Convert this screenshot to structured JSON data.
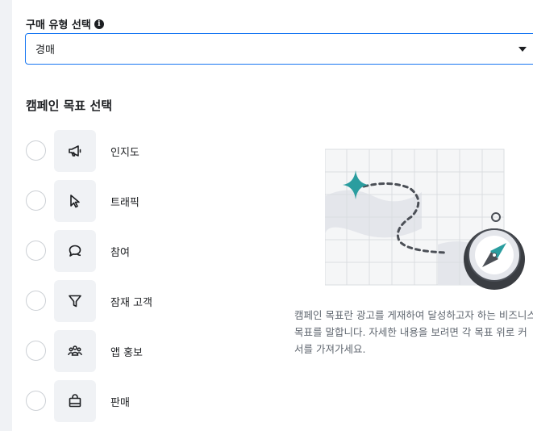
{
  "purchase_type": {
    "label": "구매 유형 선택",
    "info_icon": "info-icon",
    "selected_value": "경매"
  },
  "campaign_goal": {
    "title": "캠페인 목표 선택",
    "options": [
      {
        "label": "인지도",
        "icon": "megaphone-icon"
      },
      {
        "label": "트래픽",
        "icon": "cursor-icon"
      },
      {
        "label": "참여",
        "icon": "chat-bubble-icon"
      },
      {
        "label": "잠재 고객",
        "icon": "funnel-icon"
      },
      {
        "label": "앱 홍보",
        "icon": "people-group-icon"
      },
      {
        "label": "판매",
        "icon": "shopping-bag-icon"
      }
    ]
  },
  "help": {
    "description": "캠페인 목표란 광고를 게재하여 달성하고자 하는 비즈니스 목표를 말합니다. 자세한 내용을 보려면 각 목표 위로 커서를 가져가세요."
  },
  "colors": {
    "accent": "#1877f2",
    "teal": "#2a9d9f",
    "panel_bg": "#ffffff",
    "page_bg": "#f0f2f5"
  }
}
